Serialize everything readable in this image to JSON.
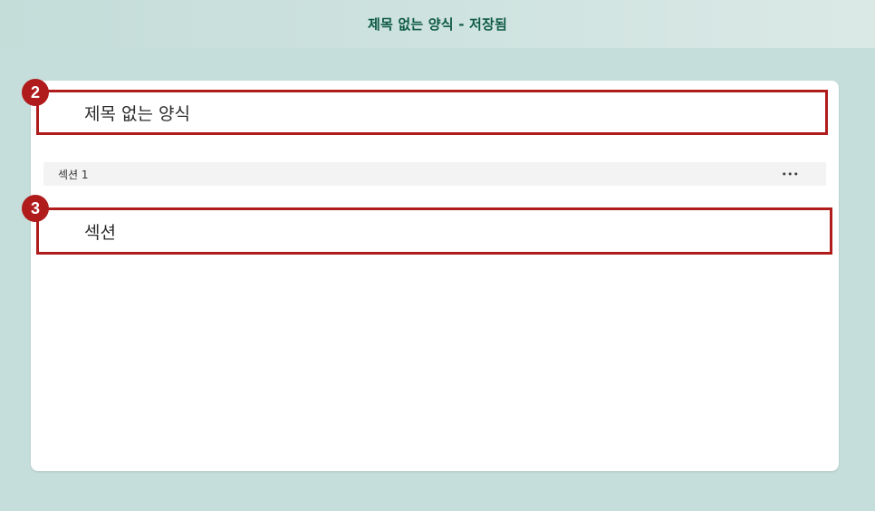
{
  "header": {
    "title": "제목 없는 양식 - 저장됨"
  },
  "form": {
    "title": "제목 없는 양식",
    "section_label": "섹션 1",
    "more_glyph": "•••",
    "section_title": "섹션"
  },
  "annotations": {
    "badge_title": "2",
    "badge_section": "3"
  },
  "colors": {
    "background": "#c5dedb",
    "header_text": "#0e5a44",
    "highlight": "#b01c1c",
    "card": "#ffffff"
  }
}
